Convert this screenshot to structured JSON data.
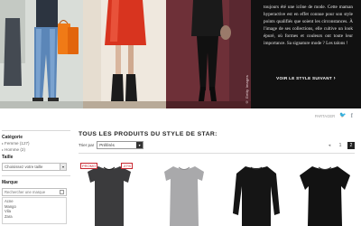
{
  "hero": {
    "body": "toujours été une icône de mode. Cette maman hyperactive est en effet connue pour son style points qualifiés que soient les circonstances. À l'image de ses collections, elle cultive un look épuré, où formes et couleurs ont toute leur importance. Sa signature mode ? Les talons !",
    "cta_label": "VOIR LE STYLE SUIVANT",
    "cta_arrow": "›",
    "photo_credit": "© Getty Images"
  },
  "share": {
    "label": "PARTAGER",
    "twitter_glyph": "🐦",
    "facebook_glyph": "f"
  },
  "sidebar": {
    "category_heading": "Catégorie",
    "categories": [
      {
        "label": "Femme (127)"
      },
      {
        "label": "Homme (2)"
      }
    ],
    "size_heading": "Taille",
    "size_select_value": "Choisissez votre taille",
    "brand_heading": "Marque",
    "brand_search_placeholder": "Rechercher une marque",
    "brands": [
      "Acne",
      "Mango",
      "Vila",
      "Zara"
    ]
  },
  "main": {
    "section_title": "TOUS LES PRODUITS DU STYLE DE STAR:",
    "sort_label": "Trier par",
    "sort_value": "Préférés",
    "pager": {
      "prev": "◂",
      "page1": "1",
      "page2": "2"
    },
    "badges": {
      "promo": "PROMO",
      "discount": "-37%"
    }
  },
  "colors": {
    "hero_panel": "#111111",
    "accent_red": "#c8262f",
    "pager_active": "#222222"
  }
}
